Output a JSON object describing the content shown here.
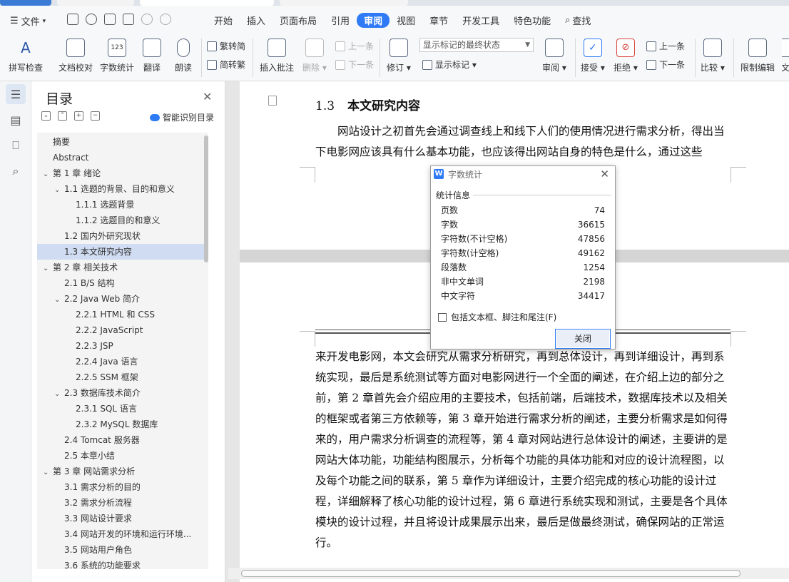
{
  "menubar": {
    "file_label": "文件",
    "items": [
      "开始",
      "插入",
      "页面布局",
      "引用",
      "审阅",
      "视图",
      "章节",
      "开发工具",
      "特色功能"
    ],
    "active": "审阅",
    "search_label": "查找"
  },
  "ribbon": {
    "spell_check": "拼写检查",
    "doc_proofread": "文档校对",
    "word_count": "字数统计",
    "translate": "翻译",
    "read_aloud": "朗读",
    "trad_to_simp": "繁转简",
    "simp_to_trad": "简转繁",
    "insert_comment": "插入批注",
    "delete": "删除",
    "prev_comment": "上一条",
    "next_comment": "下一条",
    "revise": "修订",
    "markup_state": "显示标记的最终状态",
    "show_markup": "显示标记",
    "review": "审阅",
    "accept": "接受",
    "reject": "拒绝",
    "prev_change": "上一条",
    "next_change": "下一条",
    "compare": "比较",
    "restrict_edit": "限制编辑",
    "cut_off": "文"
  },
  "toc": {
    "title": "目录",
    "smart_label": "智能识别目录",
    "items": [
      {
        "text": "摘要",
        "level": 0,
        "chev": ""
      },
      {
        "text": "Abstract",
        "level": 0,
        "chev": ""
      },
      {
        "text": "第 1 章  绪论",
        "level": 0,
        "chev": "⌄"
      },
      {
        "text": "1.1  选题的背景、目的和意义",
        "level": 1,
        "chev": "⌄"
      },
      {
        "text": "1.1.1  选题背景",
        "level": 2,
        "chev": ""
      },
      {
        "text": "1.1.2  选题目的和意义",
        "level": 2,
        "chev": ""
      },
      {
        "text": "1.2  国内外研究现状",
        "level": 1,
        "chev": ""
      },
      {
        "text": "1.3  本文研究内容",
        "level": 1,
        "chev": "",
        "selected": true
      },
      {
        "text": "第 2 章  相关技术",
        "level": 0,
        "chev": "⌄"
      },
      {
        "text": "2.1  B/S 结构",
        "level": 1,
        "chev": ""
      },
      {
        "text": "2.2  Java Web 简介",
        "level": 1,
        "chev": "⌄"
      },
      {
        "text": "2.2.1  HTML 和 CSS",
        "level": 2,
        "chev": ""
      },
      {
        "text": "2.2.2  JavaScript",
        "level": 2,
        "chev": ""
      },
      {
        "text": "2.2.3  JSP",
        "level": 2,
        "chev": ""
      },
      {
        "text": "2.2.4  Java 语言",
        "level": 2,
        "chev": ""
      },
      {
        "text": "2.2.5  SSM 框架",
        "level": 2,
        "chev": ""
      },
      {
        "text": "2.3  数据库技术简介",
        "level": 1,
        "chev": "⌄"
      },
      {
        "text": "2.3.1  SQL 语言",
        "level": 2,
        "chev": ""
      },
      {
        "text": "2.3.2  MySQL 数据库",
        "level": 2,
        "chev": ""
      },
      {
        "text": "2.4  Tomcat 服务器",
        "level": 1,
        "chev": ""
      },
      {
        "text": "2.5  本章小结",
        "level": 1,
        "chev": ""
      },
      {
        "text": "第 3 章  网站需求分析",
        "level": 0,
        "chev": "⌄"
      },
      {
        "text": "3.1  需求分析的目的",
        "level": 1,
        "chev": ""
      },
      {
        "text": "3.2  需求分析流程",
        "level": 1,
        "chev": ""
      },
      {
        "text": "3.3  网站设计要求",
        "level": 1,
        "chev": ""
      },
      {
        "text": "3.4  网站开发的环境和运行环境...",
        "level": 1,
        "chev": ""
      },
      {
        "text": "3.5  网站用户角色",
        "level": 1,
        "chev": ""
      },
      {
        "text": "3.6  系统的功能要求",
        "level": 1,
        "chev": ""
      }
    ]
  },
  "document": {
    "heading_num": "1.3",
    "heading_text": "本文研究内容",
    "para1": "网站设计之初首先会通过调查线上和线下人们的使用情况进行需求分析，得出当下电影网应该具有什么基本功能，也应该得出网站自身的特色是什么，通过这些",
    "para2": "来开发电影网，本文会研究从需求分析研究，再到总体设计，再到详细设计，再到系统实现，最后是系统测试等方面对电影网进行一个全面的阐述，在介绍上边的部分之前，第 2 章首先会介绍应用的主要技术，包括前端，后端技术，数据库技术以及相关的框架或者第三方依赖等，第 3 章开始进行需求分析的阐述，主要分析需求是如何得来的，用户需求分析调查的流程等，第 4 章对网站进行总体设计的阐述，主要讲的是网站大体功能，功能结构图展示，分析每个功能的具体功能和对应的设计流程图，以及每个功能之间的联系，第 5 章作为详细设计，主要介绍完成的核心功能的设计过程，详细解释了核心功能的设计过程，第 6 章进行系统实现和测试，主要是各个具体模块的设计过程，并且将设计成果展示出来，最后是做最终测试，确保网站的正常运行。"
  },
  "dialog": {
    "title": "字数统计",
    "section": "统计信息",
    "rows": [
      {
        "label": "页数",
        "value": "74"
      },
      {
        "label": "字数",
        "value": "36615"
      },
      {
        "label": "字符数(不计空格)",
        "value": "47856"
      },
      {
        "label": "字符数(计空格)",
        "value": "49162"
      },
      {
        "label": "段落数",
        "value": "1254"
      },
      {
        "label": "非中文单词",
        "value": "2198"
      },
      {
        "label": "中文字符",
        "value": "34417"
      }
    ],
    "checkbox_label": "包括文本框、脚注和尾注(F)",
    "close_button": "关闭"
  }
}
